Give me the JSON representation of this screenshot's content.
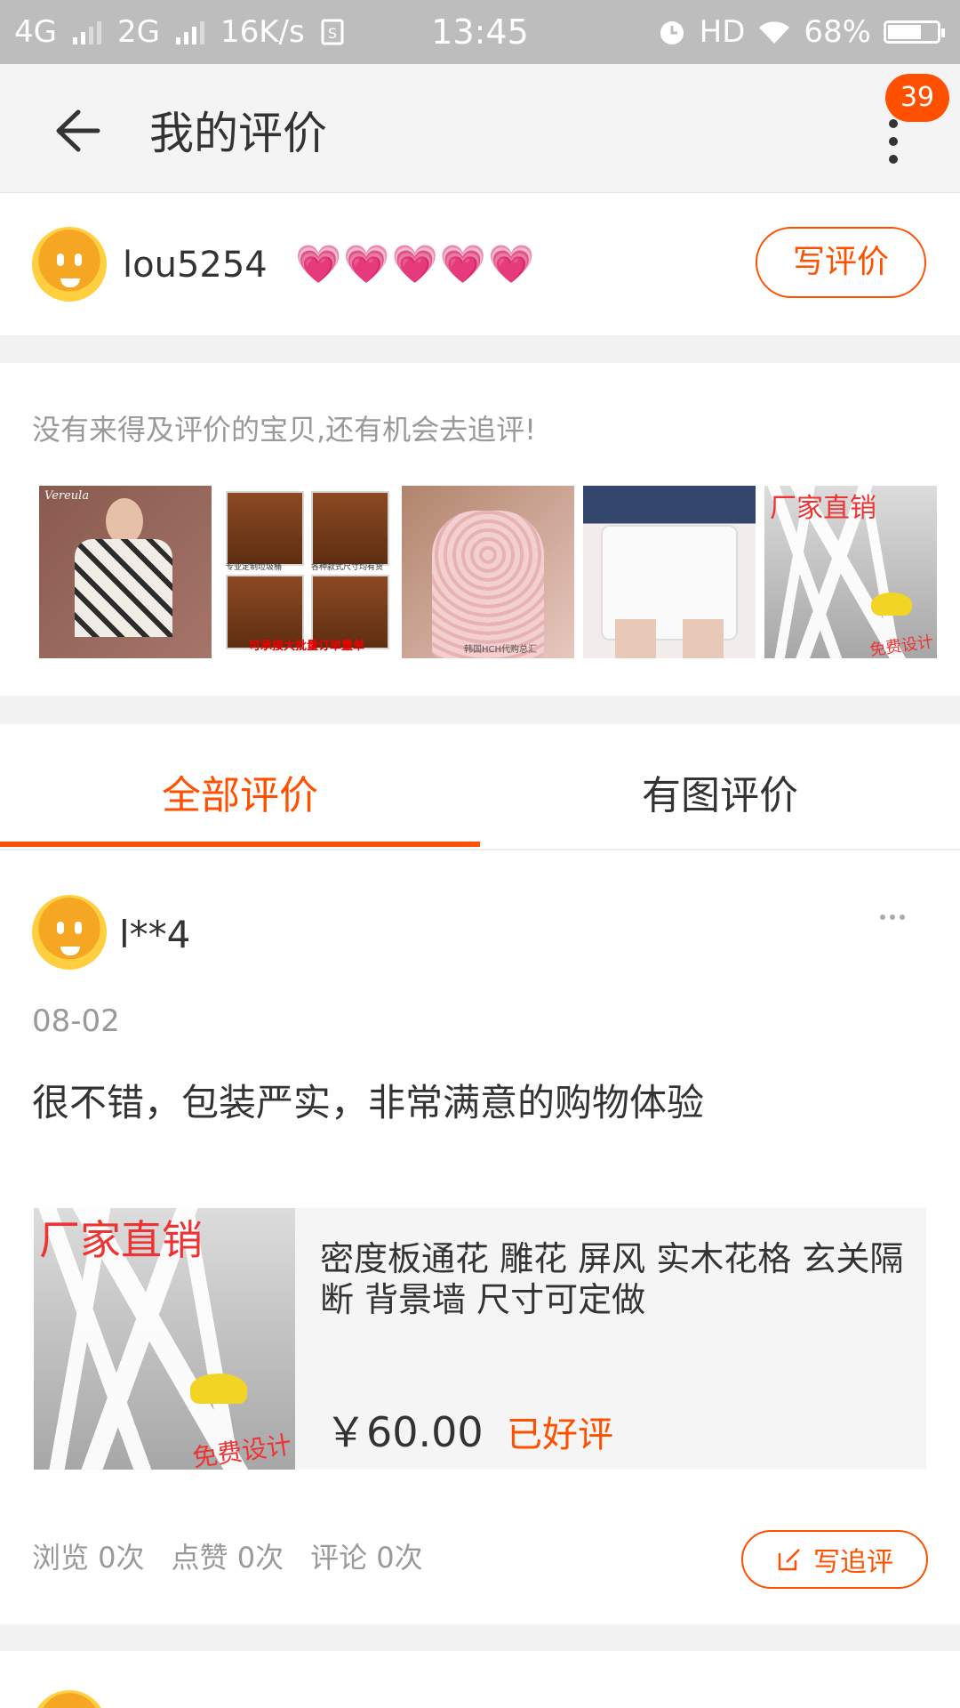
{
  "status_bar": {
    "network1": "4G",
    "network2": "2G",
    "speed": "16K/s",
    "time": "13:45",
    "hd": "HD",
    "battery": "68%",
    "battery_level": 0.68
  },
  "header": {
    "title": "我的评价",
    "badge_count": "39",
    "icons": [
      "back-arrow-icon",
      "more-vertical-icon"
    ]
  },
  "user": {
    "name": "lou5254",
    "hearts": [
      "💗",
      "💗",
      "💗",
      "💗",
      "💗"
    ],
    "write_review_label": "写评价"
  },
  "pending": {
    "hint": "没有来得及评价的宝贝,还有机会去追评!",
    "items": [
      {
        "caption": "Vereula"
      },
      {
        "labels": [
          "专业定制垃圾桶",
          "各种款式尺寸均有货",
          "可承接大批量订单量单"
        ]
      },
      {
        "caption": "韩国HCH代购总汇"
      },
      {
        "caption": ""
      },
      {
        "seal_top": "厂家直销",
        "seal_bottom": "免费设计"
      }
    ]
  },
  "tabs": {
    "all": "全部评价",
    "with_images": "有图评价",
    "active": "all"
  },
  "review": {
    "user": "l**4",
    "date": "08-02",
    "text": "很不错，包装严实，非常满意的购物体验",
    "product": {
      "name": "密度板通花 雕花 屏风 实木花格 玄关隔断 背景墙 尺寸可定做",
      "price": "￥60.00",
      "status": "已好评",
      "seal_top": "厂家直销",
      "seal_bottom": "免费设计"
    },
    "stats": {
      "views": "浏览 0次",
      "likes": "点赞 0次",
      "comments": "评论 0次"
    },
    "follow_up_label": "写追评"
  },
  "colors": {
    "accent": "#ff5000",
    "status_bar": "#bdbdbd",
    "muted": "#999999"
  }
}
